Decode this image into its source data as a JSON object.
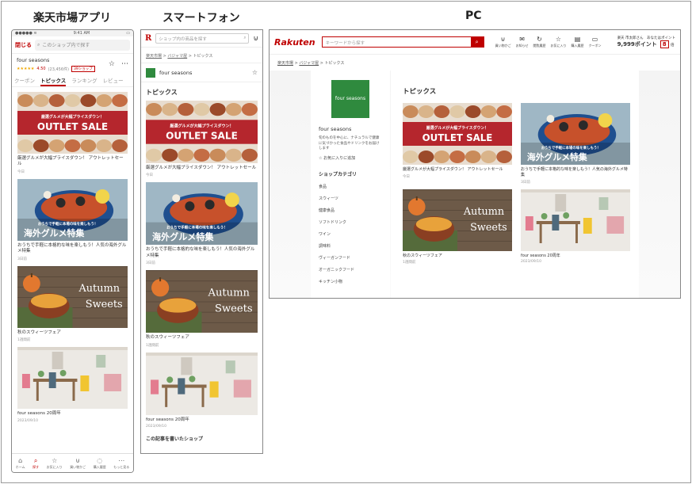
{
  "headings": {
    "app": "楽天市場アプリ",
    "sp": "スマートフォン",
    "pc": "PC"
  },
  "colors": {
    "brand": "#bf0000",
    "shop_logo": "#2f8a3e"
  },
  "articles": [
    {
      "title": "厳選グルメが大幅プライスダウン！ アウトレットセール",
      "date": "今日",
      "image": "outlet-sale",
      "banner_sub": "厳選グルメが大幅プライスダウン！",
      "banner_main": "OUTLET SALE"
    },
    {
      "title": "おうちで手軽に本格的な味を楽しもう！人気の海外グルメ特集",
      "date": "3日前",
      "image": "seafood",
      "banner_sub": "おうちで手軽に本場の味を楽しもう！",
      "banner_main": "海外グルメ特集"
    },
    {
      "title": "秋のスウィーツフェア",
      "date": "1週間前",
      "image": "autumn",
      "banner_main": "Autumn",
      "banner_main2": "Sweets"
    },
    {
      "title": "four seasons 20周年",
      "date": "2023/09/10",
      "image": "interior"
    }
  ],
  "app": {
    "status": {
      "carrier": "●●●●● ≋",
      "time": "9:41 AM",
      "battery": "▭"
    },
    "close_label": "閉じる",
    "search_placeholder": "このショップ内で探す",
    "shop_name": "four seasons",
    "stars": "★★★★★",
    "rating": "4.50",
    "review_count": "(23,456件)",
    "badge": "39ショップ",
    "tabs": [
      "クーポン",
      "トピックス",
      "ランキング",
      "レビュー"
    ],
    "tabbar": [
      {
        "icon": "⌂",
        "label": "ホーム"
      },
      {
        "icon": "⌕",
        "label": "探す"
      },
      {
        "icon": "☆",
        "label": "お気に入り"
      },
      {
        "icon": "⊍",
        "label": "買い物かご"
      },
      {
        "icon": "◌",
        "label": "購入履歴"
      },
      {
        "icon": "⋯",
        "label": "もっと見る"
      }
    ]
  },
  "sp": {
    "logo": "R",
    "search_placeholder": "ショップ内の商品を探す",
    "crumbs": [
      "楽天市場",
      "バジャマ屋",
      "トピックス"
    ],
    "shop_name": "four seasons",
    "section_title": "トピックス",
    "bottom_text": "この記事を書いたショップ"
  },
  "pc": {
    "logo": "Rakuten",
    "search_placeholder": "キーワードから探す",
    "nav": [
      {
        "icon": "⊍",
        "label": "買い物かご"
      },
      {
        "icon": "✉",
        "label": "お知らせ"
      },
      {
        "icon": "↻",
        "label": "閲覧履歴"
      },
      {
        "icon": "☆",
        "label": "お気に入り"
      },
      {
        "icon": "▤",
        "label": "購入履歴"
      },
      {
        "icon": "▭",
        "label": "クーポン"
      }
    ],
    "user_name": "楽天 市太郎さん",
    "points_label": "あなたはポイント",
    "points": "9,999ポイント",
    "rank": "8",
    "rank_unit": "倍",
    "crumbs": [
      "楽天市場",
      "バジャマ屋",
      "トピックス"
    ],
    "shop_logo_text": "four seasons",
    "shop_name": "four seasons",
    "shop_desc": "旬のものを中心に、ナチュラルで健康に気づかった食品やドリンクをお届けします",
    "fav_label": "☆ お気に入りに追加",
    "category_title": "ショップカテゴリ",
    "categories": [
      "食品",
      "スウィーツ",
      "健康食品",
      "ソフトドリンク",
      "ワイン",
      "調味料",
      "ヴィーガンフード",
      "オーガニックフード",
      "キッチン小物"
    ],
    "section_title": "トピックス"
  }
}
